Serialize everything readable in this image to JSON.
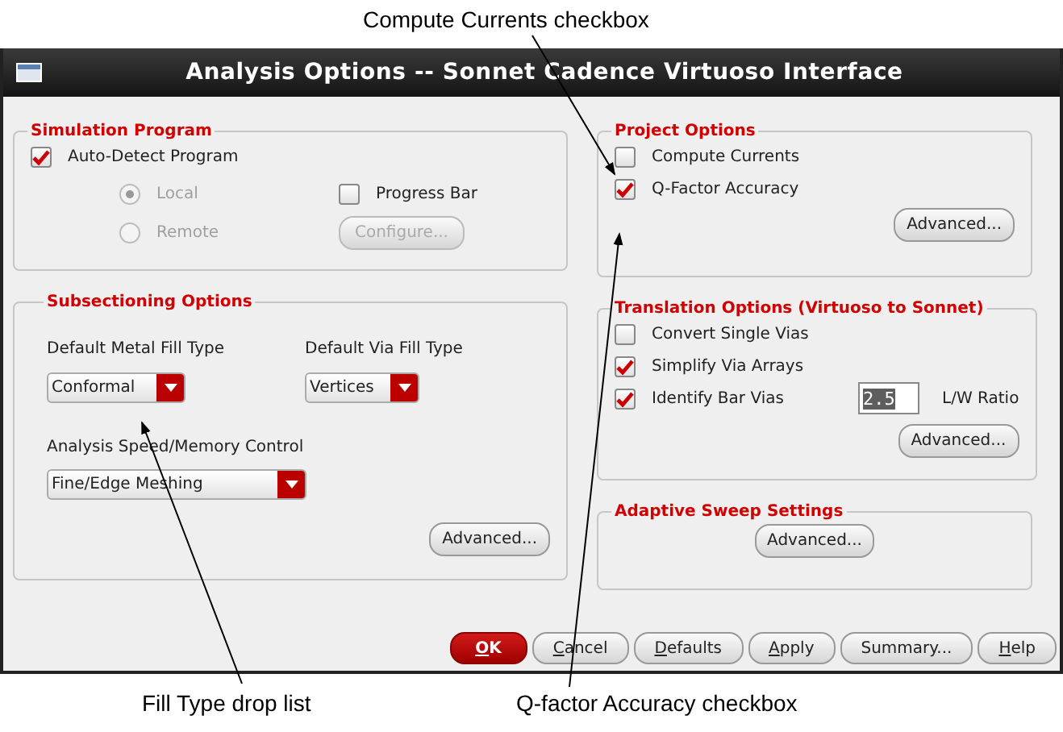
{
  "annotations": {
    "top": [
      "Compute Currents checkbox"
    ],
    "bottom": [
      "Fill Type drop list",
      "Q-factor Accuracy checkbox"
    ]
  },
  "window": {
    "title": "Analysis Options -- Sonnet Cadence Virtuoso Interface"
  },
  "simulation": {
    "title": "Simulation Program",
    "auto_detect": {
      "label": "Auto-Detect Program",
      "checked": true
    },
    "radios": [
      {
        "label": "Local",
        "selected": true,
        "disabled": true
      },
      {
        "label": "Remote",
        "selected": false,
        "disabled": true
      }
    ],
    "progress_bar": {
      "label": "Progress Bar",
      "checked": false
    },
    "configure": {
      "label": "Configure...",
      "disabled": true
    }
  },
  "subsectioning": {
    "title": "Subsectioning Options",
    "metal_fill": {
      "label": "Default Metal Fill Type",
      "value": "Conformal"
    },
    "via_fill": {
      "label": "Default Via Fill Type",
      "value": "Vertices"
    },
    "speed": {
      "label": "Analysis Speed/Memory Control",
      "value": "Fine/Edge Meshing"
    },
    "advanced": "Advanced..."
  },
  "project": {
    "title": "Project Options",
    "checkboxes": [
      {
        "label": "Compute Currents",
        "checked": false
      },
      {
        "label": "Q-Factor Accuracy",
        "checked": true
      }
    ],
    "advanced": "Advanced..."
  },
  "translation": {
    "title": "Translation Options (Virtuoso to Sonnet)",
    "checkboxes": [
      {
        "label": "Convert Single Vias",
        "checked": false
      },
      {
        "label": "Simplify Via Arrays",
        "checked": true
      },
      {
        "label": "Identify Bar Vias",
        "checked": true
      }
    ],
    "ratio": {
      "value": "2.5",
      "label": "L/W Ratio"
    },
    "advanced": "Advanced..."
  },
  "adaptive": {
    "title": "Adaptive Sweep Settings",
    "advanced": "Advanced..."
  },
  "buttons": [
    {
      "key": "O",
      "rest": "K",
      "kind": "default"
    },
    {
      "key": "C",
      "rest": "ancel",
      "kind": "normal"
    },
    {
      "key": "D",
      "rest": "efaults",
      "kind": "normal"
    },
    {
      "key": "A",
      "rest": "pply",
      "kind": "normal"
    },
    {
      "rest": "Summary...",
      "kind": "normal"
    },
    {
      "key": "H",
      "rest": "elp",
      "kind": "normal"
    }
  ]
}
